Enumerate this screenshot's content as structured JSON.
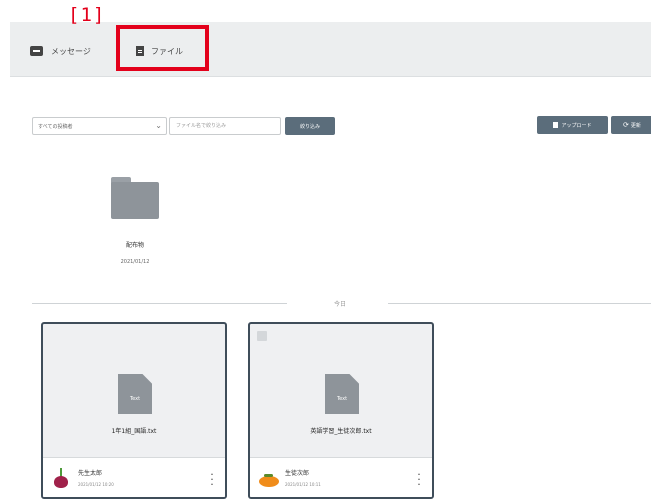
{
  "annotation": {
    "label": "[1]"
  },
  "tabs": [
    {
      "label": "メッセージ",
      "icon": "message-icon"
    },
    {
      "label": "ファイル",
      "icon": "document-icon"
    }
  ],
  "toolbar": {
    "filter_select_value": "すべての投稿者",
    "search_placeholder": "ファイル名で絞り込み",
    "filter_button": "絞り込み",
    "upload_button": "アップロード",
    "refresh_button": "更新"
  },
  "folder": {
    "name": "配布物",
    "date": "2021/01/12"
  },
  "section_label": "今日",
  "files": [
    {
      "file_type": "Text",
      "name": "1年1組_国語.txt",
      "user": "先生太郎",
      "timestamp": "2021/01/12 10:20"
    },
    {
      "file_type": "Text",
      "name": "英語学習_生徒次郎.txt",
      "user": "生徒次郎",
      "timestamp": "2021/01/12 10:11"
    }
  ],
  "colors": {
    "highlight": "#e3001b",
    "button": "#5b6d7b",
    "card_border": "#3f4d5a"
  }
}
